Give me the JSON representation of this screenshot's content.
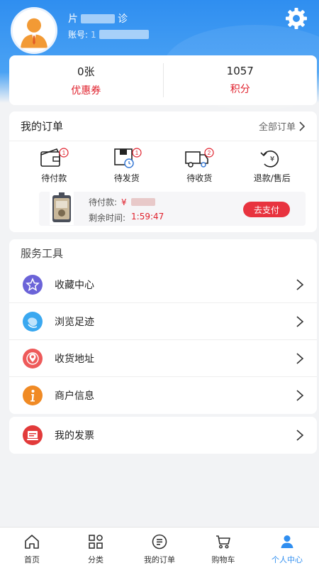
{
  "profile": {
    "name_prefix": "片",
    "name_suffix": "诊",
    "account_label": "账号:",
    "account_prefix": "1"
  },
  "stats": [
    {
      "value": "0张",
      "label": "优惠券"
    },
    {
      "value": "1057",
      "label": "积分"
    }
  ],
  "orders": {
    "title": "我的订单",
    "all_link": "全部订单",
    "statuses": [
      {
        "label": "待付款",
        "badge": "1",
        "icon": "wallet-icon"
      },
      {
        "label": "待发货",
        "badge": "1",
        "icon": "package-clock-icon"
      },
      {
        "label": "待收货",
        "badge": "2",
        "icon": "truck-icon"
      },
      {
        "label": "退款/售后",
        "badge": "",
        "icon": "refund-icon"
      }
    ],
    "pending": {
      "amount_label": "待付款:",
      "amount_prefix": "¥",
      "time_label": "剩余时间:",
      "time_value": "1:59:47",
      "pay_button": "去支付"
    }
  },
  "services": {
    "title": "服务工具",
    "items": [
      {
        "label": "收藏中心",
        "icon": "star-icon",
        "color": "#6b63d8"
      },
      {
        "label": "浏览足迹",
        "icon": "footprint-icon",
        "color": "#3aa8f0"
      },
      {
        "label": "收货地址",
        "icon": "location-icon",
        "color": "#ee5a5a"
      },
      {
        "label": "商户信息",
        "icon": "info-icon",
        "color": "#f08a24"
      },
      {
        "label": "我的发票",
        "icon": "invoice-icon",
        "color": "#e23a3a"
      }
    ]
  },
  "tabbar": [
    {
      "label": "首页",
      "icon": "home-icon",
      "active": false
    },
    {
      "label": "分类",
      "icon": "category-icon",
      "active": false
    },
    {
      "label": "我的订单",
      "icon": "order-list-icon",
      "active": false
    },
    {
      "label": "购物车",
      "icon": "cart-icon",
      "active": false
    },
    {
      "label": "个人中心",
      "icon": "user-icon",
      "active": true
    }
  ],
  "colors": {
    "brand_blue": "#2f8ef0",
    "accent_red": "#e0202c"
  }
}
